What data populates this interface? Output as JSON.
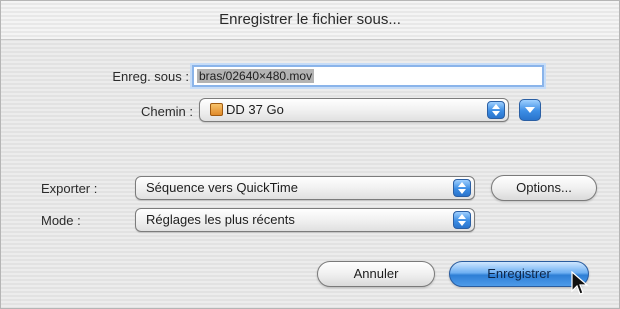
{
  "dialog": {
    "title": "Enregistrer le fichier sous..."
  },
  "fields": {
    "save_as_label": "Enreg. sous :",
    "save_as_value": "bras/02640×480.mov",
    "path_label": "Chemin :",
    "path_value": "DD 37 Go",
    "export_label": "Exporter :",
    "export_value": "Séquence vers QuickTime",
    "mode_label": "Mode :",
    "mode_value": "Réglages les plus récents"
  },
  "buttons": {
    "options": "Options...",
    "cancel": "Annuler",
    "save": "Enregistrer"
  },
  "icons": {
    "disk": "hard-drive-icon",
    "stepper": "popup-stepper-icon",
    "expand": "chevron-down-icon",
    "cursor": "arrow-cursor-icon"
  },
  "colors": {
    "accent_blue": "#3c8de4",
    "focus_ring": "#8ab4ea"
  }
}
